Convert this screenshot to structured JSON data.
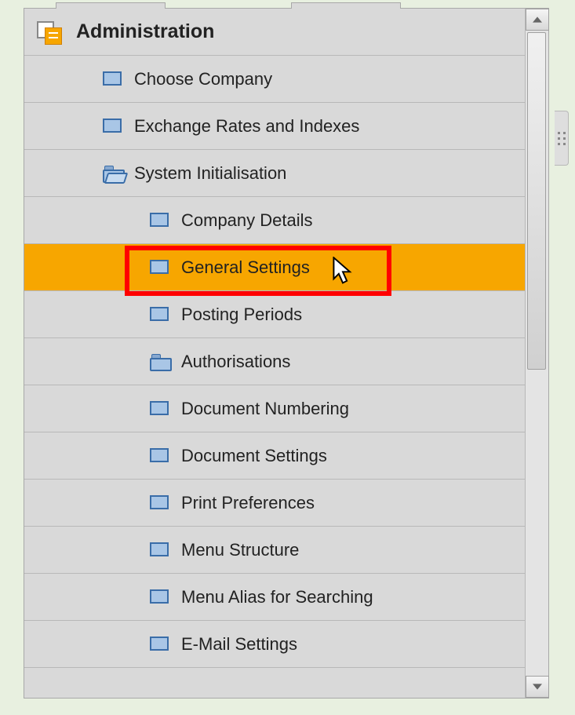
{
  "module": {
    "title": "Administration"
  },
  "tree": {
    "items": [
      {
        "label": "Choose Company",
        "icon": "item",
        "level": 1,
        "selected": false
      },
      {
        "label": "Exchange Rates and Indexes",
        "icon": "item",
        "level": 1,
        "selected": false
      },
      {
        "label": "System Initialisation",
        "icon": "folder-open",
        "level": 1,
        "selected": false
      },
      {
        "label": "Company Details",
        "icon": "item",
        "level": 2,
        "selected": false
      },
      {
        "label": "General Settings",
        "icon": "item",
        "level": 2,
        "selected": true
      },
      {
        "label": "Posting Periods",
        "icon": "item",
        "level": 2,
        "selected": false
      },
      {
        "label": "Authorisations",
        "icon": "folder",
        "level": 2,
        "selected": false
      },
      {
        "label": "Document Numbering",
        "icon": "item",
        "level": 2,
        "selected": false
      },
      {
        "label": "Document Settings",
        "icon": "item",
        "level": 2,
        "selected": false
      },
      {
        "label": "Print Preferences",
        "icon": "item",
        "level": 2,
        "selected": false
      },
      {
        "label": "Menu Structure",
        "icon": "item",
        "level": 2,
        "selected": false
      },
      {
        "label": "Menu Alias for Searching",
        "icon": "item",
        "level": 2,
        "selected": false
      },
      {
        "label": "E-Mail Settings",
        "icon": "item",
        "level": 2,
        "selected": false
      }
    ]
  },
  "colors": {
    "selection": "#f7a600",
    "highlight_border": "#ff0000"
  }
}
